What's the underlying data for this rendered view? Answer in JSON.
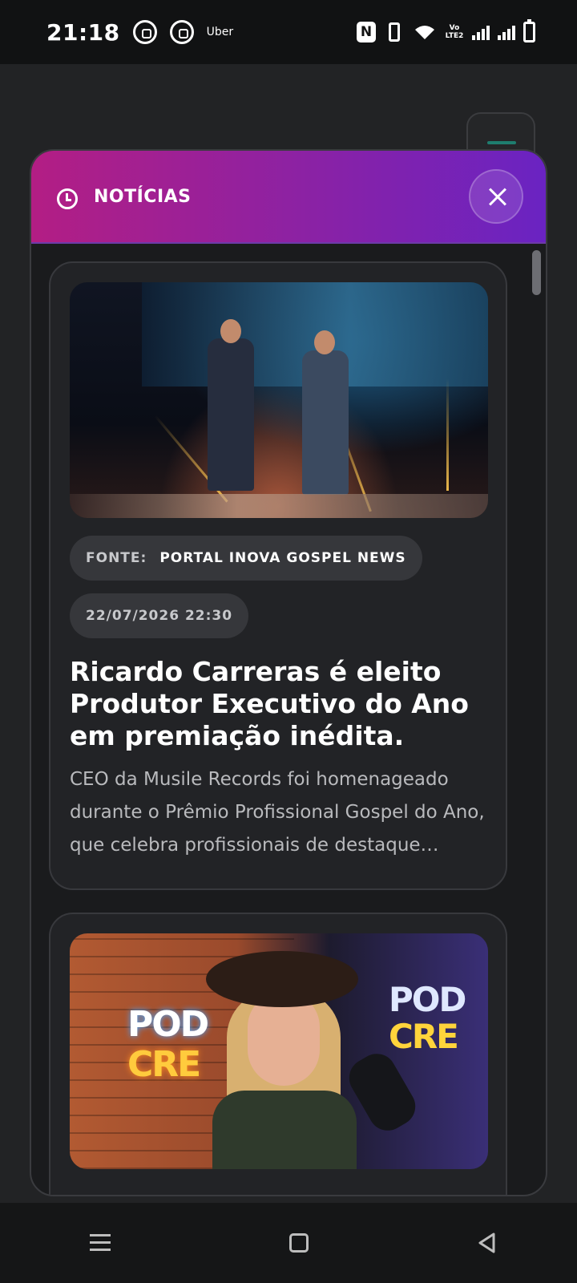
{
  "status_bar": {
    "time": "21:18",
    "notification_app": "Uber",
    "volte_label": "Vo LTE2",
    "icons": [
      "whatsapp-icon",
      "whatsapp-icon",
      "nfc-icon",
      "vibrate-icon",
      "wifi-icon",
      "signal-icon",
      "signal-icon",
      "battery-icon"
    ]
  },
  "modal": {
    "title": "NOTÍCIAS",
    "header_icon": "clock-icon",
    "close_icon": "close-icon",
    "accent_gradient": [
      "#b31e84",
      "#6a23c2"
    ]
  },
  "news": [
    {
      "source_key": "FONTE:",
      "source_value": "PORTAL INOVA GOSPEL NEWS",
      "date": "22/07/2026 22:30",
      "title": "Ricardo Carreras é eleito Produtor Executivo do Ano em premiação inédita.",
      "description": "CEO da Musile Records foi homenageado durante o Prêmio Profissional Gospel do Ano, que celebra profissionais de destaque…"
    },
    {
      "image_text_1": "POD",
      "image_text_2": "CRE"
    }
  ],
  "nav_bar": {
    "icons": [
      "menu-icon",
      "home-icon",
      "back-icon"
    ]
  }
}
